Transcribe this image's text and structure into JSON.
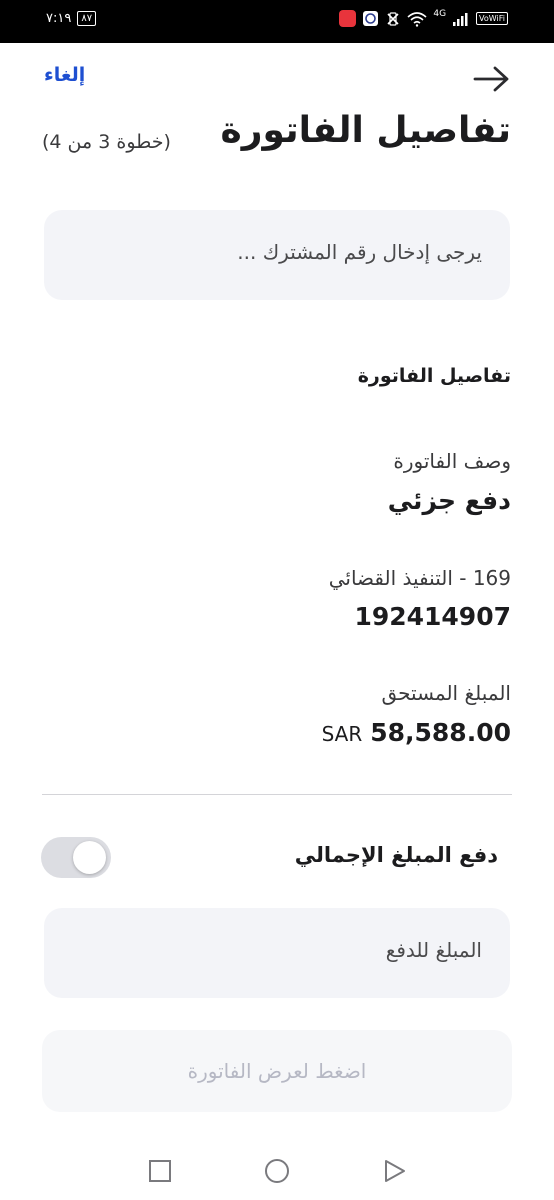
{
  "status_bar": {
    "time": "٧:١٩",
    "notification_count": "٨٧",
    "network_type": "4G",
    "volte_label": "VoWiFi"
  },
  "header": {
    "cancel_label": "إلغاء",
    "back_icon": "arrow-right-icon",
    "title": "تفاصيل الفاتورة",
    "step_text": "(خطوة 3 من 4)"
  },
  "subscriber_input": {
    "placeholder": "يرجى إدخال رقم المشترك ..."
  },
  "bill_details": {
    "section_title": "تفاصيل الفاتورة",
    "description_label": "وصف الفاتورة",
    "description_value": "دفع جزئي",
    "biller_label": "169 - التنفيذ القضائي",
    "biller_value": "192414907",
    "amount_label": "المبلغ المستحق",
    "amount_value": "58,588.00",
    "currency": "SAR"
  },
  "full_payment": {
    "label": "دفع المبلغ الإجمالي",
    "toggle_on": false
  },
  "amount_input": {
    "placeholder": "المبلغ للدفع"
  },
  "submit_button": {
    "label": "اضغط لعرض الفاتورة"
  },
  "nav_bar": {
    "items": [
      "recents-square-icon",
      "home-circle-icon",
      "back-triangle-icon"
    ]
  },
  "colors": {
    "accent": "#1e4fd1",
    "field_bg": "#f3f4f8",
    "disabled_text": "#b6b8c4"
  }
}
